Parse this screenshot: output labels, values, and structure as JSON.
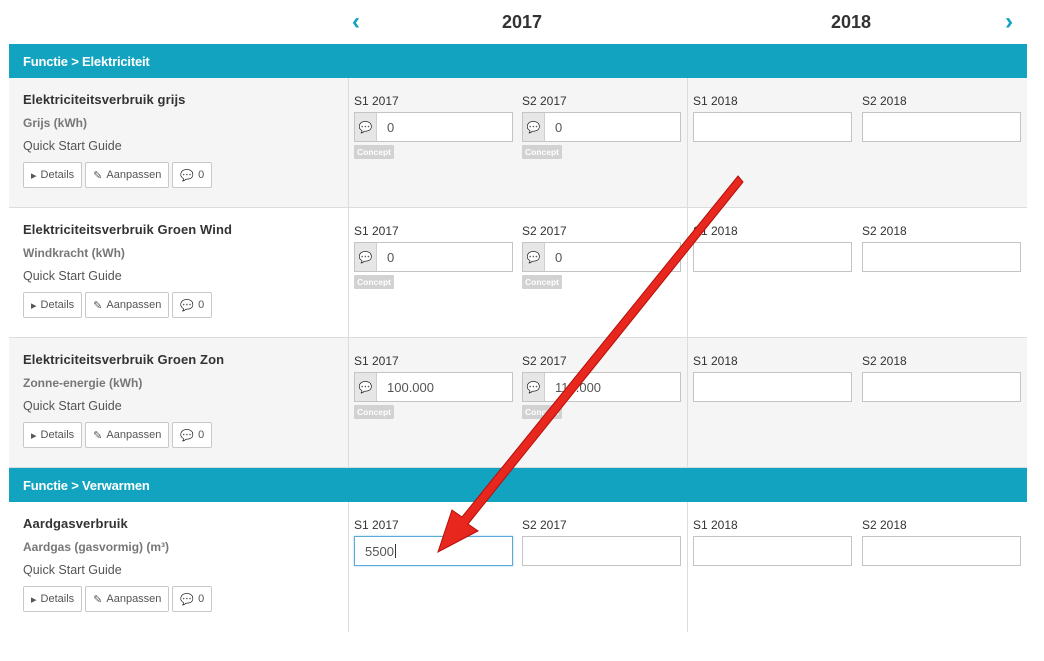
{
  "nav": {
    "prev": "‹",
    "next": "›",
    "years": [
      "2017",
      "2018"
    ]
  },
  "sections": [
    {
      "title": "Functie > Elektriciteit",
      "rows": [
        {
          "title": "Elektriciteitsverbruik grijs",
          "unit": "Grijs (kWh)",
          "guide": "Quick Start Guide",
          "buttons": {
            "details": "Details",
            "edit": "Aanpassen",
            "comments": "0"
          },
          "cells": [
            {
              "label": "S1 2017",
              "value": "0",
              "badge": "Concept"
            },
            {
              "label": "S2 2017",
              "value": "0",
              "badge": "Concept"
            },
            {
              "label": "S1 2018",
              "value": ""
            },
            {
              "label": "S2 2018",
              "value": ""
            }
          ]
        },
        {
          "title": "Elektriciteitsverbruik Groen Wind",
          "unit": "Windkracht (kWh)",
          "guide": "Quick Start Guide",
          "buttons": {
            "details": "Details",
            "edit": "Aanpassen",
            "comments": "0"
          },
          "cells": [
            {
              "label": "S1 2017",
              "value": "0",
              "badge": "Concept"
            },
            {
              "label": "S2 2017",
              "value": "0",
              "badge": "Concept"
            },
            {
              "label": "S1 2018",
              "value": ""
            },
            {
              "label": "S2 2018",
              "value": ""
            }
          ]
        },
        {
          "title": "Elektriciteitsverbruik Groen Zon",
          "unit": "Zonne-energie (kWh)",
          "guide": "Quick Start Guide",
          "buttons": {
            "details": "Details",
            "edit": "Aanpassen",
            "comments": "0"
          },
          "cells": [
            {
              "label": "S1 2017",
              "value": "100.000",
              "badge": "Concept"
            },
            {
              "label": "S2 2017",
              "value": "110.000",
              "badge": "Concept"
            },
            {
              "label": "S1 2018",
              "value": ""
            },
            {
              "label": "S2 2018",
              "value": ""
            }
          ]
        }
      ]
    },
    {
      "title": "Functie > Verwarmen",
      "rows": [
        {
          "title": "Aardgasverbruik",
          "unit": "Aardgas (gasvormig) (m³)",
          "guide": "Quick Start Guide",
          "buttons": {
            "details": "Details",
            "edit": "Aanpassen",
            "comments": "0"
          },
          "cells": [
            {
              "label": "S1 2017",
              "value": "5500"
            },
            {
              "label": "S2 2017",
              "value": ""
            },
            {
              "label": "S1 2018",
              "value": ""
            },
            {
              "label": "S2 2018",
              "value": ""
            }
          ]
        }
      ]
    }
  ],
  "colors": {
    "accent": "#12a3c1",
    "annotation_arrow": "#e8201c"
  }
}
